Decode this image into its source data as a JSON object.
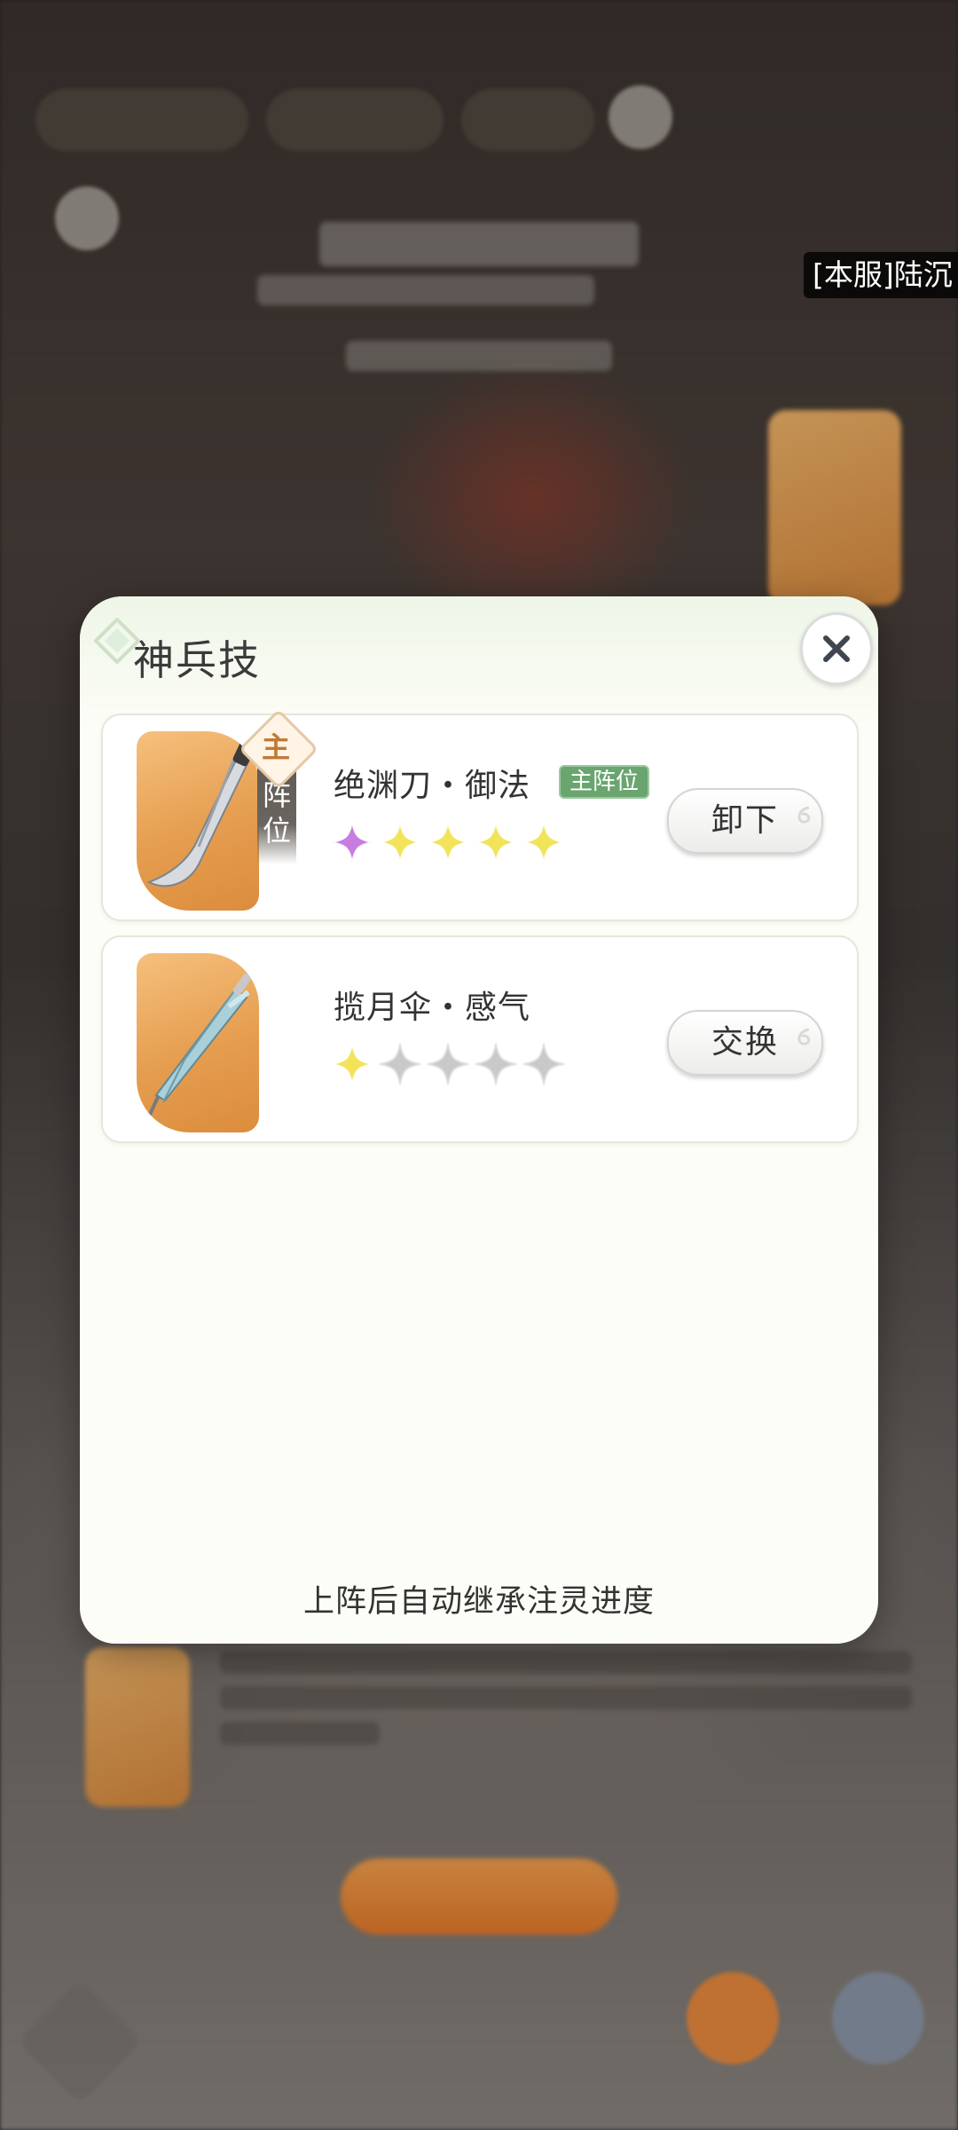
{
  "overlay": {
    "server_tag": "[本服]陆沉"
  },
  "modal": {
    "title": "神兵技",
    "close_icon": "close-icon",
    "footer_note": "上阵后自动继承注灵进度",
    "skills": [
      {
        "name": "绝渊刀・御法",
        "tag": "主阵位",
        "badge": "主",
        "ribbon": "阵\n位",
        "stars_filled": 5,
        "stars_total": 5,
        "first_star_color": "#c77ce0",
        "star_color": "#f2e35a",
        "action_label": "卸下",
        "weapon_icon": "blade-icon"
      },
      {
        "name": "揽月伞・感气",
        "stars_filled": 1,
        "stars_total": 5,
        "star_color": "#f2e35a",
        "empty_star_color": "#c9c9c9",
        "action_label": "交换",
        "weapon_icon": "umbrella-icon"
      }
    ]
  },
  "colors": {
    "modal_bg": "#fdfdf7",
    "tile_orange": "#e59d4f",
    "tag_green": "#6aa570"
  }
}
